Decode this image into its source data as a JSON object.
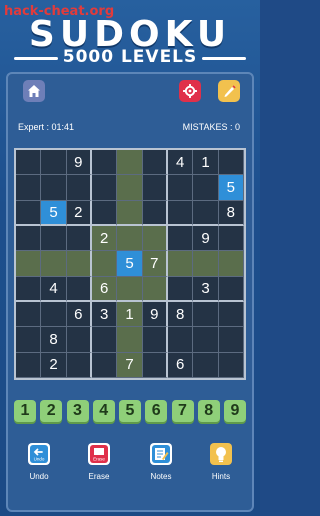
{
  "watermark": "hack-cheat.org",
  "header": {
    "title": "SUDOKU",
    "subtitle": "5000 LEVELS"
  },
  "toolbar": {
    "home_icon": "home-icon",
    "settings_icon": "gear-icon",
    "hint_icon": "pencil-icon"
  },
  "status": {
    "difficulty_time": "Expert : 01:41",
    "mistakes": "MISTAKES :  0"
  },
  "board": {
    "rows": [
      [
        "",
        "",
        "9",
        "",
        "",
        "",
        "4",
        "1",
        ""
      ],
      [
        "",
        "",
        "",
        "",
        "",
        "",
        "",
        "",
        "5"
      ],
      [
        "",
        "5",
        "2",
        "",
        "",
        "",
        "",
        "",
        "8"
      ],
      [
        "",
        "",
        "",
        "2",
        "",
        "",
        "",
        "9",
        ""
      ],
      [
        "",
        "",
        "",
        "",
        "5",
        "7",
        "",
        "",
        ""
      ],
      [
        "",
        "4",
        "",
        "6",
        "",
        "",
        "",
        "3",
        ""
      ],
      [
        "",
        "",
        "6",
        "3",
        "1",
        "9",
        "8",
        "",
        ""
      ],
      [
        "",
        "8",
        "",
        "",
        "",
        "",
        "",
        "",
        ""
      ],
      [
        "",
        "2",
        "",
        "",
        "7",
        "",
        "6",
        "",
        ""
      ]
    ],
    "selected": [
      4,
      4
    ],
    "selected_value": "5"
  },
  "numbers": [
    "1",
    "2",
    "3",
    "4",
    "5",
    "6",
    "7",
    "8",
    "9"
  ],
  "tools": [
    {
      "label": "Undo",
      "icon": "undo-icon",
      "sub": "Undo"
    },
    {
      "label": "Erase",
      "icon": "erase-icon",
      "sub": "Erase"
    },
    {
      "label": "Notes",
      "icon": "notes-icon",
      "sub": ""
    },
    {
      "label": "Hints",
      "icon": "lightbulb-icon",
      "sub": ""
    }
  ],
  "colors": {
    "background": "#1f4a86",
    "highlight": "#5a6e4c",
    "selected": "#2f8fd8",
    "number_button": "#8fcf79"
  }
}
